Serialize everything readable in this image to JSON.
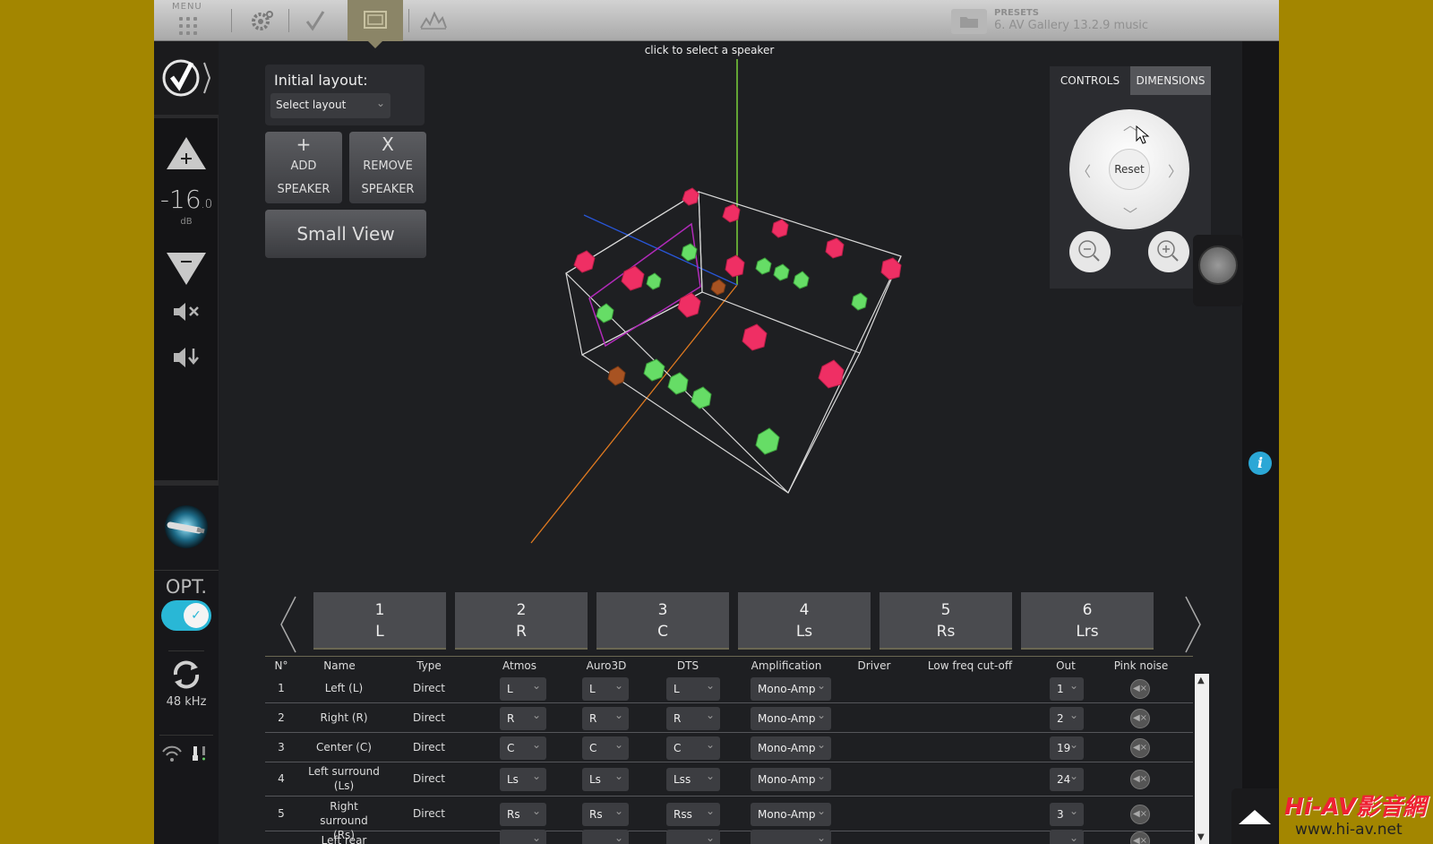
{
  "topbar": {
    "menu_label": "MENU",
    "presets_label": "PRESETS",
    "presets_value": "6. AV Gallery 13.2.9 music"
  },
  "sidebar": {
    "volume_value": "-16",
    "volume_decimal": ".0",
    "volume_unit": "dB",
    "opt_label": "OPT.",
    "opt_enabled": true,
    "sample_rate": "48 kHz"
  },
  "layout_panel": {
    "title": "Initial layout:",
    "select_value": "Select layout"
  },
  "buttons": {
    "add_symbol": "+",
    "add_line1": "ADD",
    "add_line2": "SPEAKER",
    "remove_symbol": "X",
    "remove_line1": "REMOVE",
    "remove_line2": "SPEAKER",
    "small_view": "Small View"
  },
  "viewport": {
    "hint": "click to select a speaker"
  },
  "controls_panel": {
    "tab_controls": "CONTROLS",
    "tab_dimensions": "DIMENSIONS",
    "reset": "Reset"
  },
  "speaker_tabs": [
    {
      "num": "1",
      "code": "L"
    },
    {
      "num": "2",
      "code": "R"
    },
    {
      "num": "3",
      "code": "C"
    },
    {
      "num": "4",
      "code": "Ls"
    },
    {
      "num": "5",
      "code": "Rs"
    },
    {
      "num": "6",
      "code": "Lrs"
    }
  ],
  "table": {
    "headers": {
      "n": "N°",
      "name": "Name",
      "type": "Type",
      "atmos": "Atmos",
      "auro": "Auro3D",
      "dts": "DTS",
      "amp": "Amplification",
      "driver": "Driver",
      "lowfreq": "Low freq cut-off",
      "out": "Out",
      "pink": "Pink noise"
    },
    "rows": [
      {
        "n": "1",
        "name": "Left (L)",
        "type": "Direct",
        "atmos": "L",
        "auro": "L",
        "dts": "L",
        "amp": "Mono-Amp",
        "out": "1"
      },
      {
        "n": "2",
        "name": "Right (R)",
        "type": "Direct",
        "atmos": "R",
        "auro": "R",
        "dts": "R",
        "amp": "Mono-Amp",
        "out": "2"
      },
      {
        "n": "3",
        "name": "Center (C)",
        "type": "Direct",
        "atmos": "C",
        "auro": "C",
        "dts": "C",
        "amp": "Mono-Amp",
        "out": "19"
      },
      {
        "n": "4",
        "name": "Left surround (Ls)",
        "type": "Direct",
        "atmos": "Ls",
        "auro": "Ls",
        "dts": "Lss",
        "amp": "Mono-Amp",
        "out": "24"
      },
      {
        "n": "5",
        "name": "Right surround (Rs)",
        "type": "Direct",
        "atmos": "Rs",
        "auro": "Rs",
        "dts": "Rss",
        "amp": "Mono-Amp",
        "out": "3"
      },
      {
        "n": "",
        "name": "Left rear",
        "type": "",
        "atmos": "",
        "auro": "",
        "dts": "",
        "amp": "",
        "out": ""
      }
    ]
  },
  "watermark": {
    "logo": "Hi-AV影音網",
    "url": "www.hi-av.net"
  }
}
